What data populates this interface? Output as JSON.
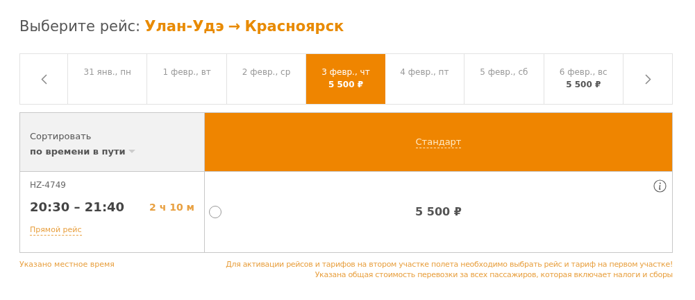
{
  "heading": {
    "label": "Выберите рейс:",
    "from": "Улан-Удэ",
    "arrow": "→",
    "to": "Красноярск"
  },
  "dates": [
    {
      "label": "31 янв., пн",
      "selected": false
    },
    {
      "label": "1 февр., вт",
      "selected": false
    },
    {
      "label": "2 февр., ср",
      "selected": false
    },
    {
      "label": "3 февр., чт",
      "price": "5 500 ₽",
      "selected": true
    },
    {
      "label": "4 февр., пт",
      "selected": false
    },
    {
      "label": "5 февр., сб",
      "selected": false
    },
    {
      "label": "6 февр., вс",
      "price": "5 500 ₽",
      "selected": false
    }
  ],
  "table": {
    "sort_label": "Сортировать",
    "sort_value": "по времени в пути",
    "fare_column": "Стандарт",
    "rows": [
      {
        "flight": "HZ-4749",
        "times": "20:30 – 21:40",
        "duration": "2 ч 10 м",
        "type": "Прямой рейс",
        "price": "5 500 ₽",
        "selected": false
      }
    ]
  },
  "notes": {
    "left": "Указано местное время",
    "right": [
      "Для активации рейсов и тарифов на втором участке полета необходимо выбрать рейс и тариф на первом участке!",
      "Указана общая стоимость перевозки за всех пассажиров, которая включает налоги и сборы"
    ]
  }
}
